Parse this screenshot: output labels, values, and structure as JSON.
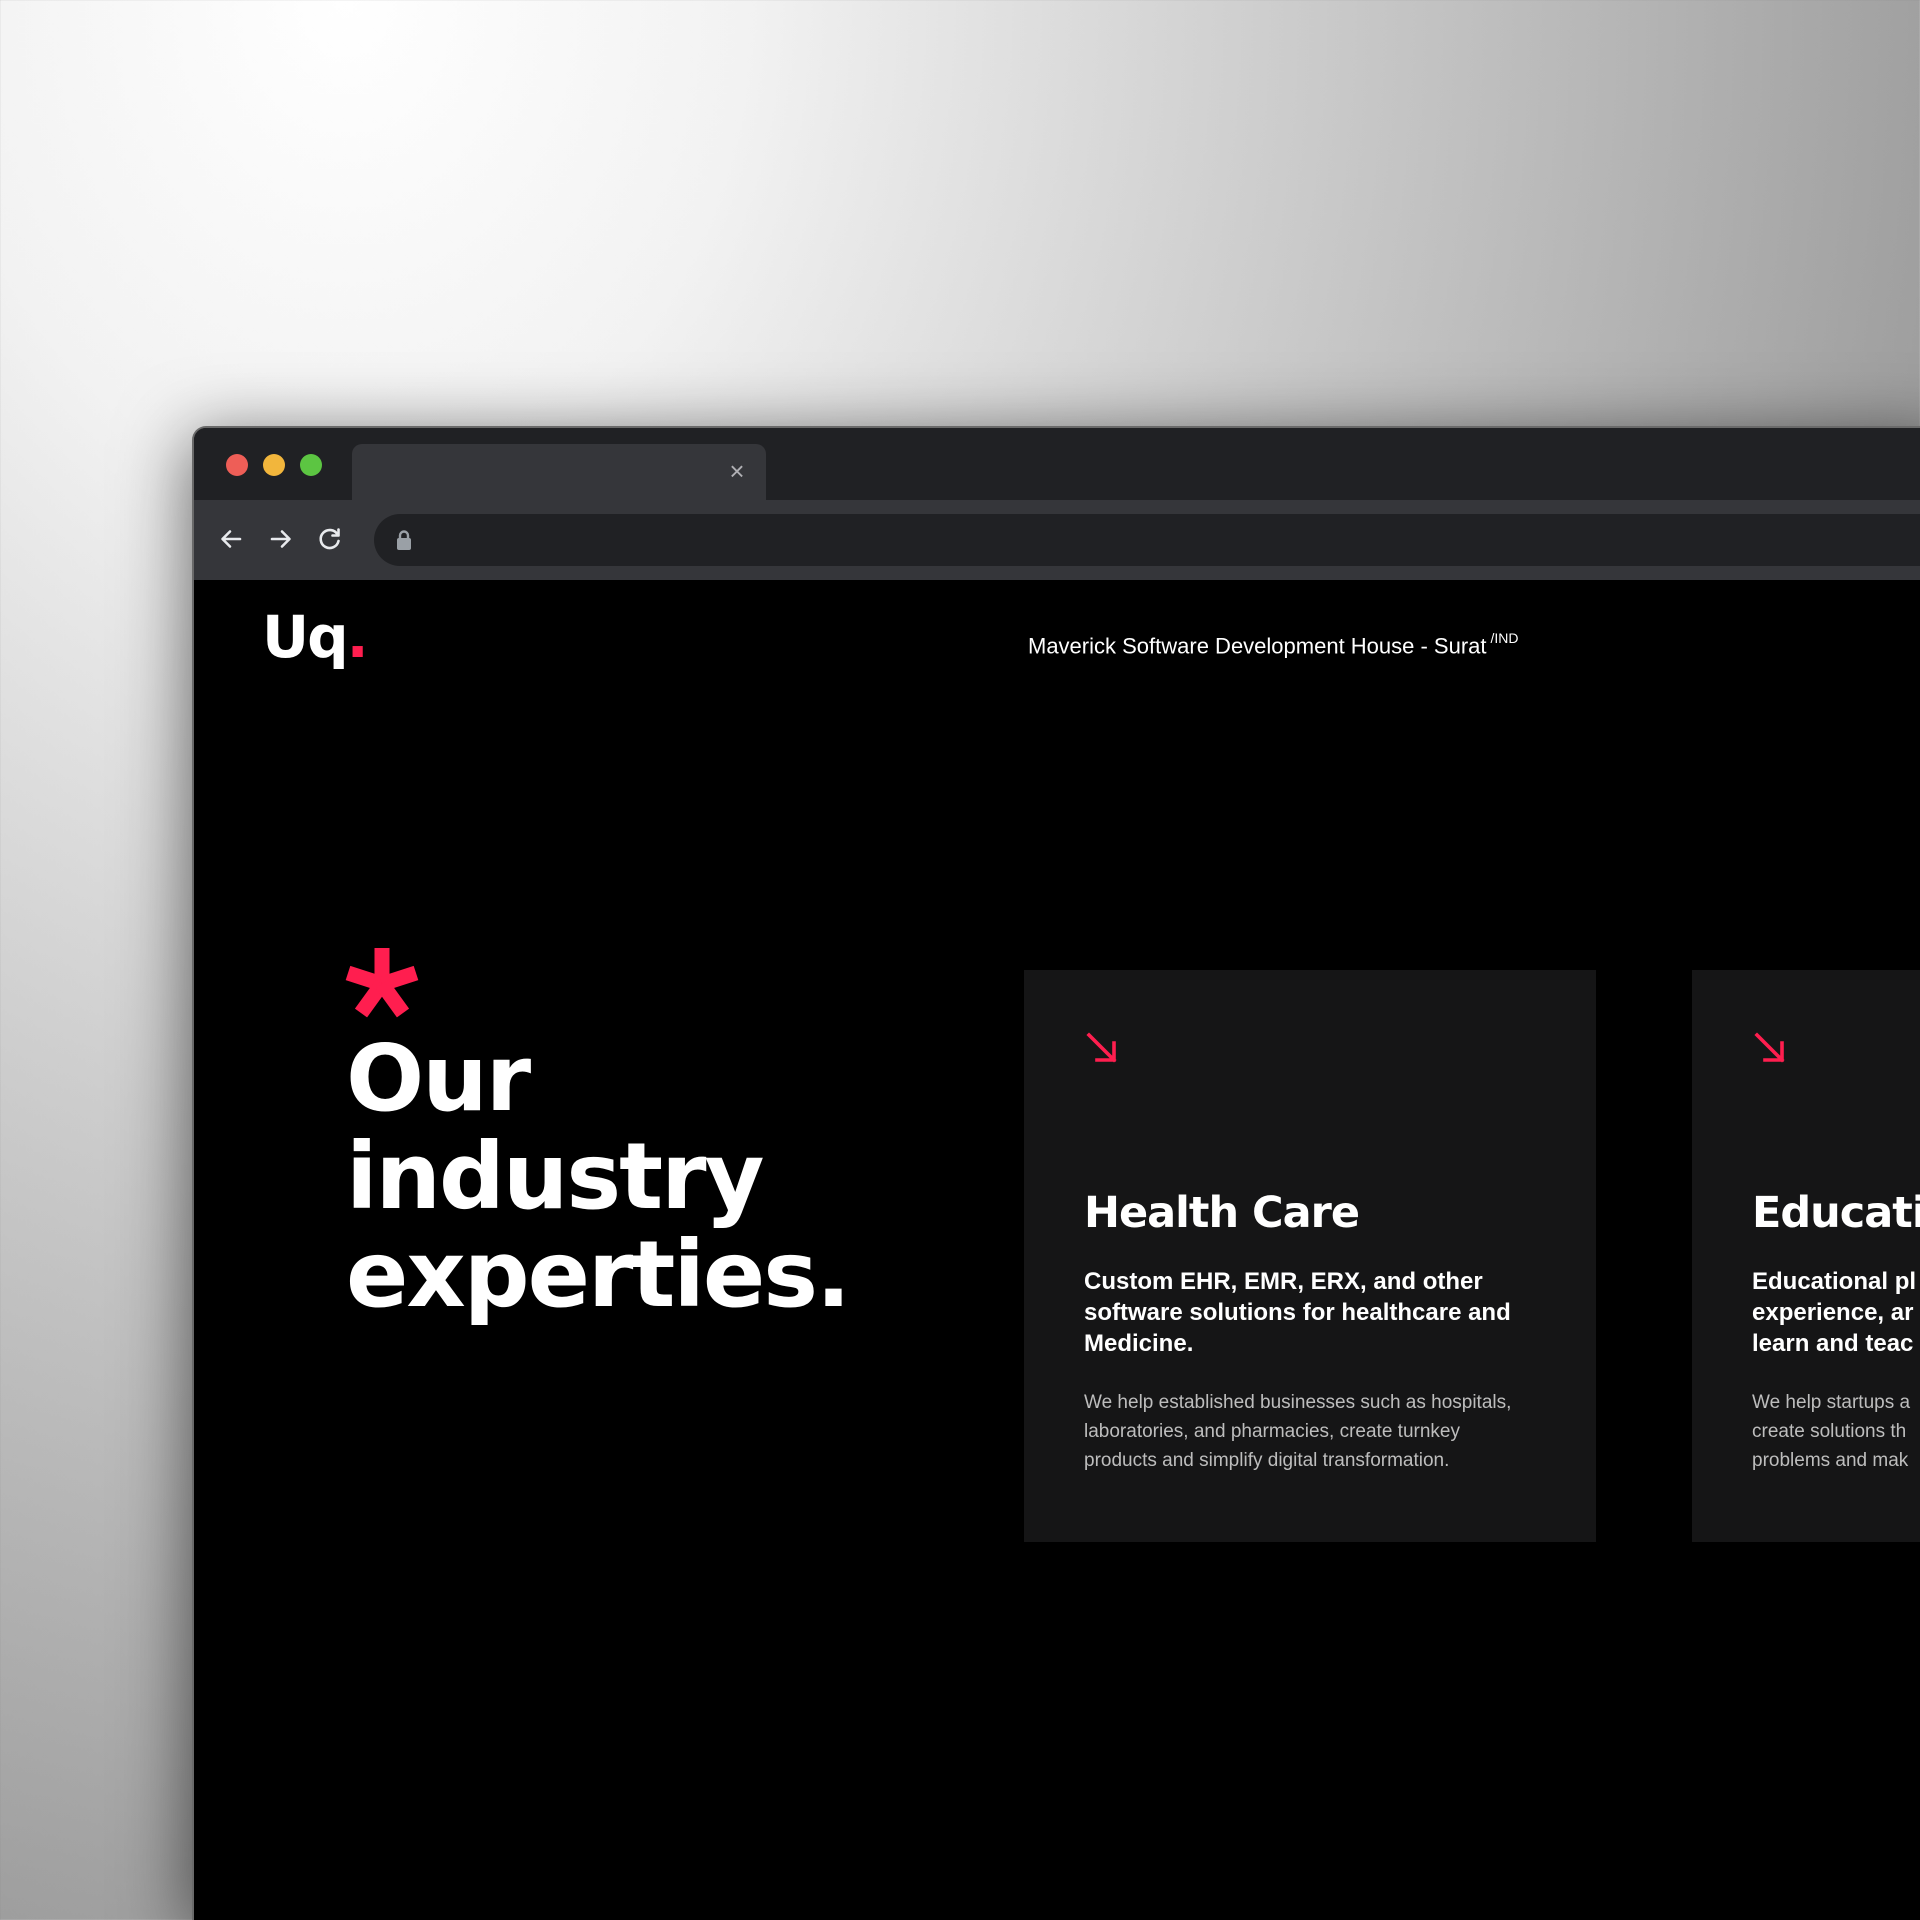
{
  "colors": {
    "accent": "#ff1e4f",
    "page_background": "#000000",
    "card_background": "#151516",
    "browser_chrome": "#202124"
  },
  "browser": {
    "tab_close_icon": "close-icon",
    "nav_icons": [
      "back-arrow-icon",
      "forward-arrow-icon",
      "reload-icon"
    ],
    "address_icon": "lock-icon"
  },
  "header": {
    "logo_letters": "Uq",
    "logo_dot": ".",
    "tagline": "Maverick Software Development House - Surat",
    "tagline_superscript": "/IND"
  },
  "hero": {
    "heading_line_1": "Our",
    "heading_line_2": "industry",
    "heading_line_3": "experties."
  },
  "cards": [
    {
      "title": "Health Care",
      "subtitle": "Custom EHR, EMR, ERX, and other software solutions for healthcare and Medicine.",
      "body": "We help established businesses such as hospitals, laboratories, and pharmacies, create turnkey products and simplify digital transformation."
    },
    {
      "title": "Educatio",
      "subtitle": "Educational pl\nexperience, ar\nlearn and teac",
      "body": "We help startups a\ncreate solutions th\nproblems and mak"
    }
  ]
}
